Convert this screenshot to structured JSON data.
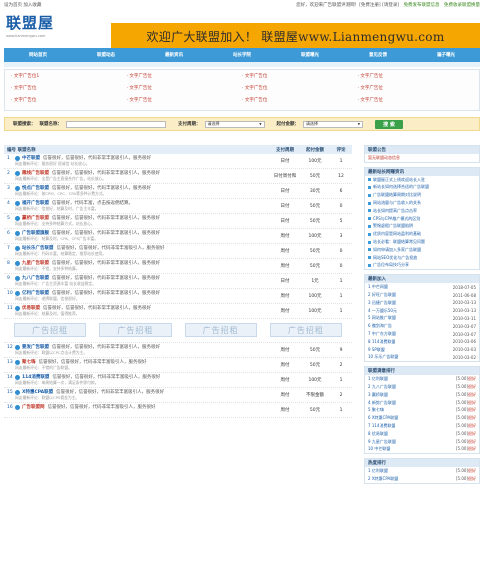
{
  "topbar": {
    "left": "设为首页  加入收藏",
    "welcome": "您好，欢迎来广告联盟评测网！[免费注册] [请登录]",
    "promo": "免费发布联盟信息",
    "promo2": "免费收录联盟换量"
  },
  "logo": {
    "name": "联盟屋",
    "sub": "www.lianmengwu.com"
  },
  "banner": "欢迎广大联盟加入！ 联盟屋www.Lianmengwu.com",
  "nav": [
    "网站首页",
    "联盟动态",
    "最新资讯",
    "站长学院",
    "联盟曝光",
    "意见反馈",
    "骗子曝光"
  ],
  "links": [
    "文字广告位1",
    "文字广告位",
    "文字广告位",
    "文字广告位",
    "文字广告位",
    "文字广告位",
    "文字广告位",
    "文字广告位",
    "文字广告位",
    "文字广告位",
    "文字广告位",
    "文字广告位"
  ],
  "search": {
    "name_label": "联盟搜索：",
    "name_field": "联盟名称：",
    "cycle_label": "支付周期：",
    "cycle_value": "请选择",
    "limit_label": "起付金额：",
    "limit_value": "请选择",
    "button": "搜 索"
  },
  "list": {
    "headers": [
      "编号 联盟名称",
      "支付周期",
      "起付金额",
      "评论"
    ],
    "rows": [
      {
        "num": "1",
        "name": "中芒联盟",
        "desc": "信誉很好，信誉很好，代码非常丰富吸引人，服务很好",
        "note": "网友最新评论：服务很好 很诚信 站长放心。",
        "cycle": "日付",
        "amount": "100元",
        "comments": "1"
      },
      {
        "num": "2",
        "name": "趣线广告联盟",
        "desc": "信誉很好，信誉很好，代码非常丰富吸引人，服务很好",
        "note": "网友最新评论：全是广告主直接合作广告，站长放心。",
        "cycle": "日付周付和",
        "amount": "50元",
        "comments": "12"
      },
      {
        "num": "3",
        "name": "悦点广告联盟",
        "desc": "信誉很好，信誉很好，代码丰富吸引人，服务很好",
        "note": "网友最新评论：按CPM、CPC、CPA等多种计费方式。",
        "cycle": "日付",
        "amount": "30元",
        "comments": "6"
      },
      {
        "num": "4",
        "name": "福开广告联盟",
        "desc": "信誉很好，代码丰富，点击按返佣结算。",
        "note": "网友最新评论：信誉好，结算及时，广告主丰富。",
        "cycle": "日付",
        "amount": "50元",
        "comments": "0"
      },
      {
        "num": "5",
        "name": "赢桥广告联盟",
        "desc": "信誉很好，信誉很好，代码非常丰富吸引人，服务很好",
        "note": "网友最新评论：支持多种结算方式，站长放心。",
        "cycle": "日付",
        "amount": "50元",
        "comments": "5"
      },
      {
        "num": "6",
        "name": "广告联盟旗舰",
        "desc": "信誉很好，信誉很好，代码非常丰富吸引人，服务很好",
        "note": "网友最新评论：结算及时，CPA、CPS广告丰富。",
        "cycle": "周付",
        "amount": "100元",
        "comments": "3"
      },
      {
        "num": "7",
        "name": "站长乐广告联盟",
        "desc": "信誉很好，信誉很好，代码非常丰富吸引人，服务很好",
        "note": "网友最新评论：代码丰富，结算稳定，推荐站长使用。",
        "cycle": "周付",
        "amount": "50元",
        "comments": "0"
      },
      {
        "num": "8",
        "name": "九星广告联盟",
        "desc": "信誉很好，信誉很好，代码非常丰富吸引人，服务很好",
        "note": "网友最新评论：不错，支持多种结算。",
        "cycle": "周付",
        "amount": "50元",
        "comments": "0"
      },
      {
        "num": "9",
        "name": "九八广告联盟",
        "desc": "信誉很好，信誉很好，代码非常丰富吸引人，服务很好",
        "note": "网友最新评论：广告主资源丰富 站长收益稳定。",
        "cycle": "日付",
        "amount": "1元",
        "comments": "1"
      },
      {
        "num": "10",
        "name": "亿利广告联盟",
        "desc": "信誉很好，信誉很好，代码非常丰富吸引人，服务很好",
        "note": "网友最新评论：老牌联盟，信誉很好。",
        "cycle": "周付",
        "amount": "100元",
        "comments": "1"
      },
      {
        "num": "11",
        "name": "优易联盟",
        "desc": "信誉很好，信誉很好，代码非常丰富吸引人，服务很好",
        "note": "网友最新评论：结算及时，值得推荐。",
        "cycle": "周付",
        "amount": "100元",
        "comments": "1"
      }
    ],
    "ads": [
      "广告招租",
      "广告招租",
      "广告招租",
      "广告招租"
    ],
    "rows2": [
      {
        "num": "12",
        "name": "要发广告联盟",
        "desc": "信誉很好，信誉很好，代码非常丰富吸引人，服务很好",
        "note": "网友最新评论：联盟以CPC点击计费为主。",
        "cycle": "周付",
        "amount": "50元",
        "comments": "9"
      },
      {
        "num": "13",
        "name": "聚七嗨",
        "desc": "信誉很好，信誉很好，代码非常丰富吸引人，服务很好",
        "note": "网友最新评论：不错的广告联盟。",
        "cycle": "周付",
        "amount": "50元",
        "comments": "2"
      },
      {
        "num": "14",
        "name": "114消费联盟",
        "desc": "信誉很好，信誉很好，代码非常丰富吸引人，服务很好",
        "note": "网友最新评论：每周结算一次，满足条件即付款。",
        "cycle": "周付",
        "amount": "100元",
        "comments": "1"
      },
      {
        "num": "15",
        "name": "X特惠CPA联盟",
        "desc": "信誉很好，信誉很好，代码非常丰富吸引人，服务很好",
        "note": "网友最新评论：联盟以CPS佣金为主。",
        "cycle": "周付",
        "amount": "不限金额",
        "comments": "2"
      },
      {
        "num": "16",
        "name": "广告联盟网",
        "desc": "信誉很好，信誉很好，代码非常丰富吸引人，服务很好",
        "note": "",
        "cycle": "周付",
        "amount": "50元",
        "comments": "1"
      }
    ]
  },
  "side": {
    "notice_title": "联盟公告",
    "notice": "暂无联盟动态信息",
    "news_title": "最新站长网赚资讯",
    "news": [
      "联盟屋正式上线欢迎站长入驻",
      "新站长如何选择合适的广告联盟",
      "广告联盟结算周期对比说明",
      "网站流量与广告收入的关系",
      "站长如何提高广告点击率",
      "CPS与CPA推广模式的区别",
      "警惕虚假广告联盟陷阱",
      "优质内容是网站盈利的基础",
      "站长必看：联盟结算常见问题",
      "如何申请加入多家广告联盟",
      "网站SEO优化与广告投放",
      "广告位布局技巧分享"
    ],
    "join_title": "最新加入",
    "join": [
      {
        "name": "1 中芒网盟",
        "date": "2018-07-05"
      },
      {
        "name": "2 好旺广告联盟",
        "date": "2011-06-08"
      },
      {
        "name": "3 迅捷广告联盟",
        "date": "2010-03-13"
      },
      {
        "name": "4 一万盟乐50元",
        "date": "2010-03-13"
      },
      {
        "name": "5 网站推广联盟",
        "date": "2010-03-11"
      },
      {
        "name": "6 傲剑海广告",
        "date": "2010-03-07"
      },
      {
        "name": "7 中广东方联盟",
        "date": "2010-03-07"
      },
      {
        "name": "8 114消费联盟",
        "date": "2010-03-06"
      },
      {
        "name": "9 SP联盟",
        "date": "2010-03-03"
      },
      {
        "name": "10 乐乐广告联盟",
        "date": "2010-03-02"
      }
    ],
    "rank_title": "联盟满意排行",
    "rank": [
      {
        "name": "1 亿利联盟",
        "score": "[5.00]",
        "level": "很好"
      },
      {
        "name": "2 九八广告联盟",
        "score": "[5.00]",
        "level": "很好"
      },
      {
        "name": "3 赢桥联盟",
        "score": "[5.00]",
        "level": "很好"
      },
      {
        "name": "4 新势广告联盟",
        "score": "[5.00]",
        "level": "很好"
      },
      {
        "name": "5 聚七嗨",
        "score": "[5.00]",
        "level": "很好"
      },
      {
        "name": "6 X特惠CPA联盟",
        "score": "[5.00]",
        "level": "很好"
      },
      {
        "name": "7 114消费联盟",
        "score": "[5.00]",
        "level": "很好"
      },
      {
        "name": "8 优易联盟",
        "score": "[5.00]",
        "level": "很好"
      },
      {
        "name": "9 九星广告联盟",
        "score": "[5.00]",
        "level": "很好"
      },
      {
        "name": "10 中芒联盟",
        "score": "[5.00]",
        "level": "很好"
      }
    ],
    "hot_title": "热度排行",
    "hot": [
      {
        "name": "1 亿利联盟",
        "score": "[5.00]",
        "level": "很好"
      },
      {
        "name": "2 X特惠CPA联盟",
        "score": "[5.00]",
        "level": "很好"
      }
    ]
  }
}
